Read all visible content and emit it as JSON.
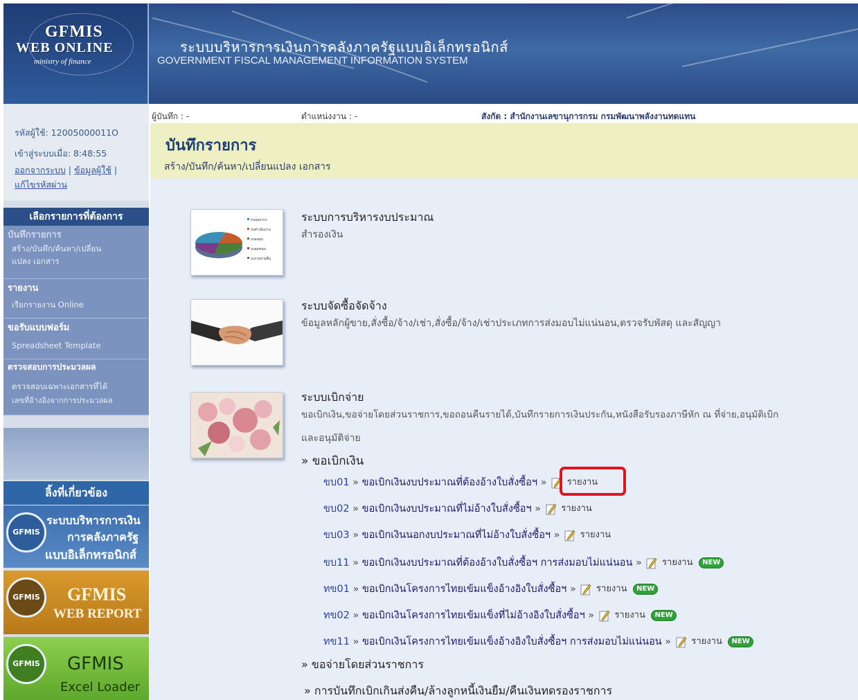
{
  "header": {
    "logo_line1": "GFMIS",
    "logo_line2": "WEB ONLINE",
    "logo_line3": "ministry of finance",
    "title_th": "ระบบบริหารการเงินการคลังภาครัฐแบบอิเล็กทรอนิกส์",
    "title_en": "GOVERNMENT FISCAL MANAGEMENT INFORMATION SYSTEM"
  },
  "user": {
    "user_id": "รหัสผู้ใช้: 12005000011O",
    "login_time": "เข้าสู่ระบบเมื่อ: 8:48:55",
    "logout_link": "ออกจากระบบ",
    "user_info_link": "ข้อมูลผู้ใช้",
    "change_password_link": "แก้ไขรหัสผ่าน"
  },
  "info_bar": {
    "recorder": "ผู้บันทึก : -",
    "position": "ตำแหน่งงาน : -",
    "affiliation": "สังกัด : สำนักงานเลขานุการกรม กรมพัฒนาพลังงานทดแทน"
  },
  "sidebar": {
    "menu_heading": "เลือกรายการที่ต้องการ",
    "items": [
      {
        "title": "บันทึกรายการ",
        "sub1": "สร้าง/บันทึก/ค้นหา/เปลี่ยน",
        "sub2": "แปลง เอกสาร"
      },
      {
        "title": "รายงาน",
        "sub1": "เรียกรายงาน Online",
        "sub2": ""
      },
      {
        "title": "ขอรับแบบฟอร์ม",
        "sub1": "Spreadsheet Template",
        "sub2": ""
      },
      {
        "title": "ตรวจสอบการประมวลผล",
        "sub1": "ตรวจสอบเฉพาะเอกสารที่ได้",
        "sub2": "เลขที่อ้างอิงจากการประมวลผล"
      }
    ],
    "links_heading": "ลิ้งที่เกี่ยวข้อง",
    "banners": [
      {
        "logo": "GFMIS",
        "text1": "ระบบบริหารการเงิน",
        "text2": "การคลังภาครัฐ",
        "text3": "แบบอิเล็กทรอนิกส์"
      },
      {
        "logo": "GFMIS",
        "text1": "GFMIS",
        "text2": "WEB REPORT",
        "text3": ""
      },
      {
        "logo": "GFMIS",
        "text1": "GFMIS",
        "text2": "Excel Loader",
        "text3": ""
      }
    ]
  },
  "page": {
    "title": "บันทึกรายการ",
    "subtitle": "สร้าง/บันทึก/ค้นหา/เปลี่ยนแปลง เอกสาร"
  },
  "systems": [
    {
      "title": "ระบบการบริหารงบประมาณ",
      "desc": "สำรองเงิน",
      "legend": [
        "งบบุคลากร",
        "งบดำเนินงาน",
        "งบลงทุน",
        "งบอุดหนุน",
        "งบรายจ่ายอื่น"
      ]
    },
    {
      "title": "ระบบจัดซื้อจัดจ้าง",
      "desc": "ข้อมูลหลักผู้ขาย,สั่งซื้อ/จ้าง/เช่า,สั่งซื้อ/จ้าง/เช่าประเภทการส่งมอบไม่แน่นอน,ตรวจรับพัสดุ และสัญญา"
    },
    {
      "title": "ระบบเบิกจ่าย",
      "desc1": "ขอเบิกเงิน,ขอจ่ายโดยส่วนราชการ,ขอถอนคืนรายได้,บันทึกรายการเงินประกัน,หนังสือรับรองภาษีหัก ณ ที่จ่าย,อนุมัติเบิก",
      "desc2": "และอนุมัติจ่าย"
    }
  ],
  "disbursement": {
    "group_withdraw": "» ขอเบิกเงิน",
    "rows": [
      {
        "code": "ขบ01",
        "name": "ขอเบิกเงินงบประมาณที่ต้องอ้างใบสั่งซื้อฯ",
        "report": "รายงาน",
        "is_new": false
      },
      {
        "code": "ขบ02",
        "name": "ขอเบิกเงินงบประมาณที่ไม่อ้างใบสั่งซื้อฯ",
        "report": "รายงาน",
        "is_new": false
      },
      {
        "code": "ขบ03",
        "name": "ขอเบิกเงินนอกงบประมาณที่ไม่อ้างใบสั่งซื้อฯ",
        "report": "รายงาน",
        "is_new": false
      },
      {
        "code": "ขบ11",
        "name": "ขอเบิกเงินงบประมาณที่ต้องอ้างใบสั่งซื้อฯ การส่งมอบไม่แน่นอน",
        "report": "รายงาน",
        "is_new": true
      },
      {
        "code": "ทข01",
        "name": "ขอเบิกเงินโครงการไทยเข้มแข็งอ้างอิงใบสั่งซื้อฯ",
        "report": "รายงาน",
        "is_new": true
      },
      {
        "code": "ทข02",
        "name": "ขอเบิกเงินโครงการไทยเข้มแข็งที่ไม่อ้างอิงใบสั่งซื้อฯ",
        "report": "รายงาน",
        "is_new": true
      },
      {
        "code": "ทข11",
        "name": "ขอเบิกเงินโครงการไทยเข้มแข็งอ้างอิงใบสั่งซื้อฯ การส่งมอบไม่แน่นอน",
        "report": "รายงาน",
        "is_new": true
      }
    ],
    "arrow": "»",
    "new_label": "NEW",
    "group_pay": "» ขอจ่ายโดยส่วนราชการ",
    "group_return": "» การบันทึกเบิกเกินส่งคืน/ล้างลูกหนี้เงินยืม/คืนเงินทดรองราชการ"
  },
  "colors": {
    "header_blue": "#2c4d87",
    "title_bg": "#eef0c4",
    "content_bg": "#e8eef7",
    "highlight_red": "#e0141a",
    "new_green": "#2fa33a"
  }
}
